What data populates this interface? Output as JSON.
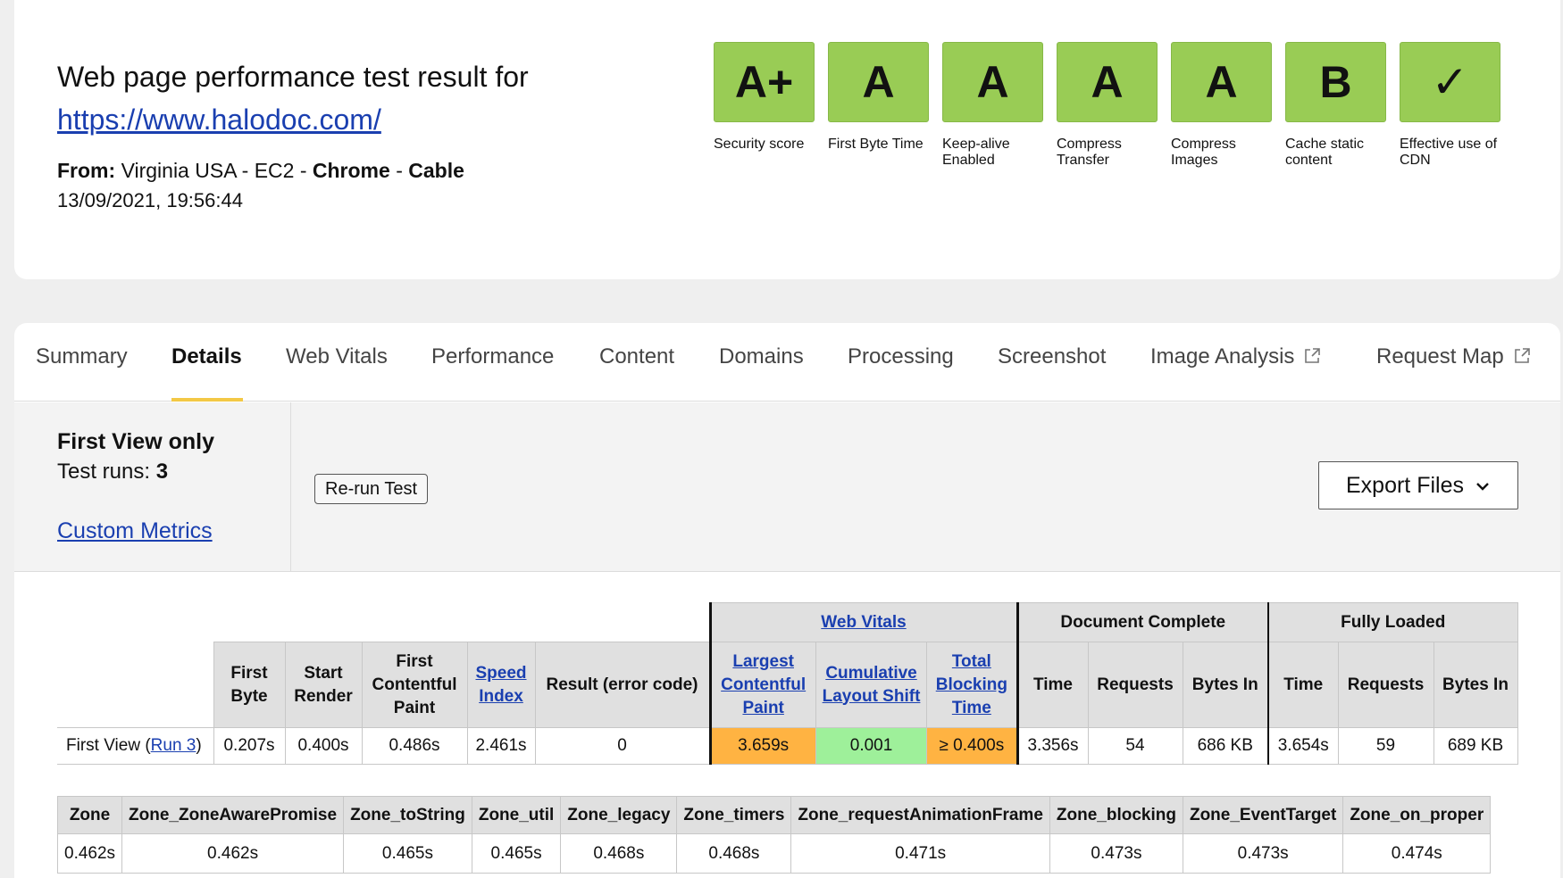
{
  "header": {
    "title": "Web page performance test result for",
    "url": "https://www.halodoc.com/",
    "from_label": "From:",
    "location": "Virginia USA - EC2 -",
    "browser": "Chrome",
    "sep": "-",
    "connection": "Cable",
    "datetime": "13/09/2021, 19:56:44"
  },
  "grades": [
    {
      "grade": "A+",
      "label": "Security score"
    },
    {
      "grade": "A",
      "label": "First Byte Time"
    },
    {
      "grade": "A",
      "label": "Keep-alive Enabled"
    },
    {
      "grade": "A",
      "label": "Compress Transfer"
    },
    {
      "grade": "A",
      "label": "Compress Images"
    },
    {
      "grade": "B",
      "label": "Cache static content"
    },
    {
      "grade": "✓",
      "label": "Effective use of CDN"
    }
  ],
  "tabs": [
    "Summary",
    "Details",
    "Web Vitals",
    "Performance",
    "Content",
    "Domains",
    "Processing",
    "Screenshot",
    "Image Analysis",
    "Request Map"
  ],
  "info": {
    "view": "First View only",
    "runs_label": "Test runs:",
    "runs": "3",
    "custom_metrics": "Custom Metrics",
    "rerun": "Re-run Test",
    "export": "Export Files"
  },
  "results": {
    "group_web_vitals": "Web Vitals",
    "group_doc": "Document Complete",
    "group_full": "Fully Loaded",
    "headers": [
      "First Byte",
      "Start Render",
      "First Contentful Paint",
      "Speed Index",
      "Result (error code)",
      "Largest Contentful Paint",
      "Cumulative Layout Shift",
      "Total Blocking Time",
      "Time",
      "Requests",
      "Bytes In",
      "Time",
      "Requests",
      "Bytes In"
    ],
    "row_label": "First View (",
    "run_link": "Run 3",
    "row_label_end": ")",
    "values": [
      "0.207s",
      "0.400s",
      "0.486s",
      "2.461s",
      "0",
      "3.659s",
      "0.001",
      "≥ 0.400s",
      "3.356s",
      "54",
      "686 KB",
      "3.654s",
      "59",
      "689 KB"
    ]
  },
  "zones": {
    "headers": [
      "Zone",
      "Zone_ZoneAwarePromise",
      "Zone_toString",
      "Zone_util",
      "Zone_legacy",
      "Zone_timers",
      "Zone_requestAnimationFrame",
      "Zone_blocking",
      "Zone_EventTarget",
      "Zone_on_proper"
    ],
    "values": [
      "0.462s",
      "0.462s",
      "0.465s",
      "0.465s",
      "0.468s",
      "0.468s",
      "0.471s",
      "0.473s",
      "0.473s",
      "0.474s"
    ]
  }
}
